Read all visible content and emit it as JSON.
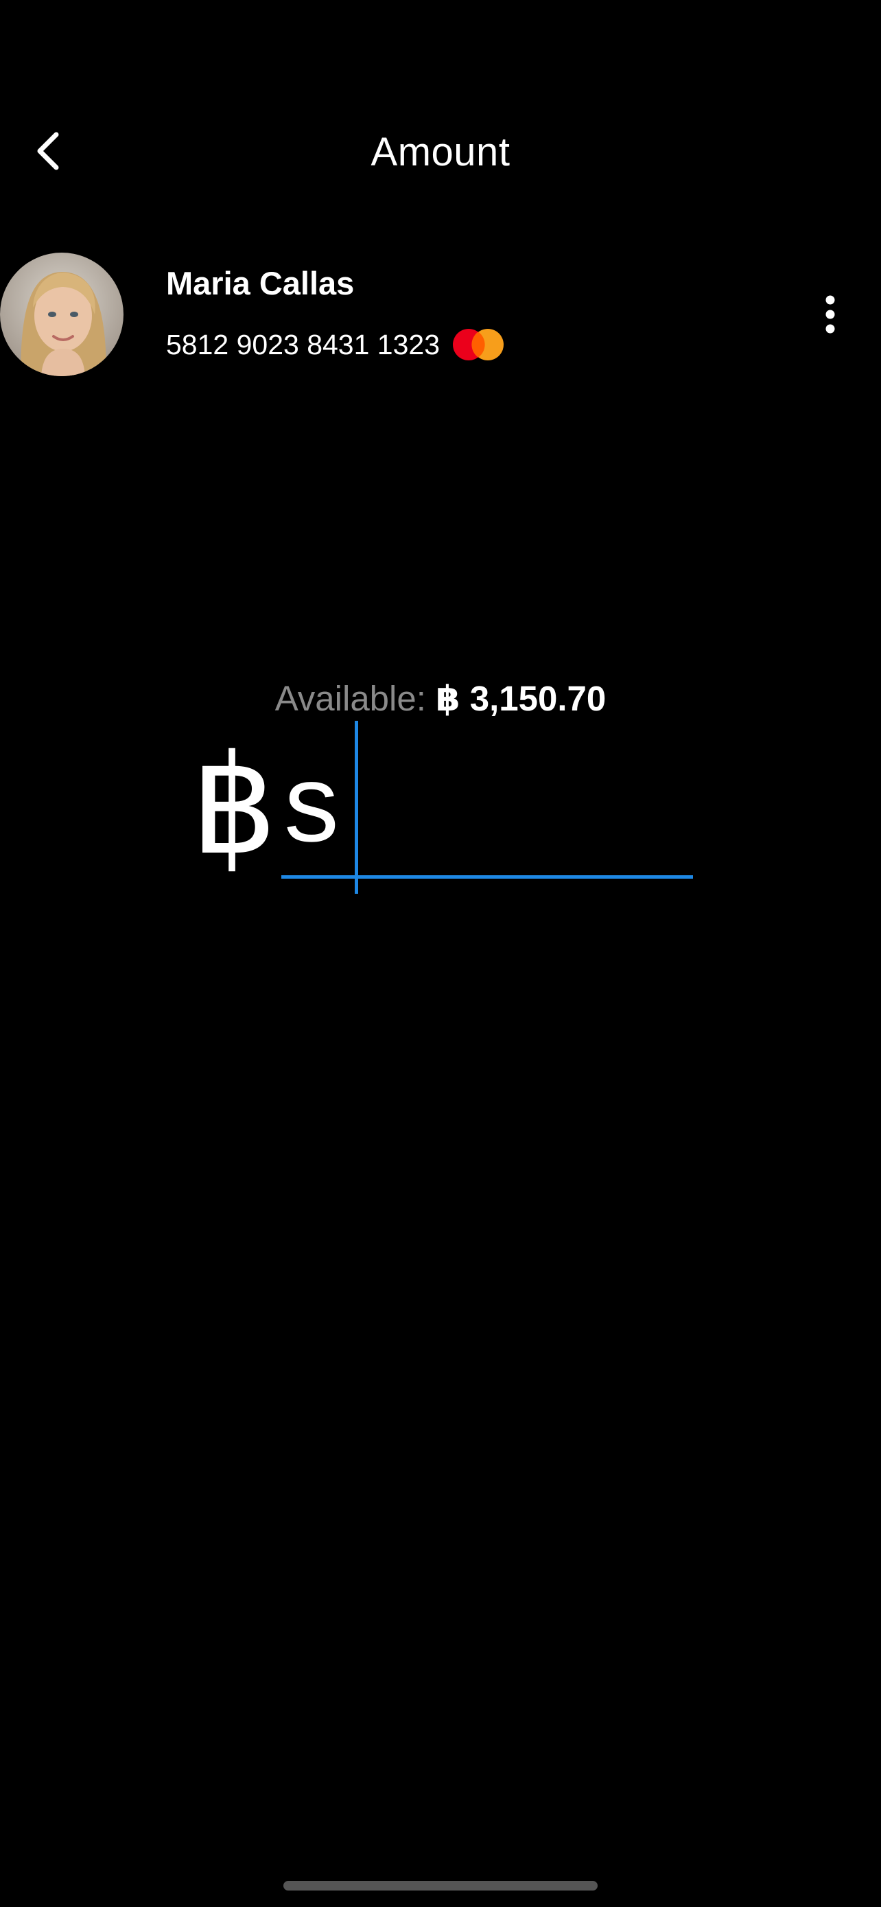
{
  "header": {
    "title": "Amount",
    "back_icon": "chevron-left-icon"
  },
  "recipient": {
    "name": "Maria Callas",
    "card_number": "5812 9023 8431 1323",
    "card_brand_icon": "mastercard-icon",
    "more_icon": "more-vertical-icon"
  },
  "balance": {
    "label": "Available:",
    "amount": "฿ 3,150.70"
  },
  "amount_entry": {
    "currency_symbol": "฿",
    "value": "s",
    "accent_color": "#1e88e5"
  }
}
